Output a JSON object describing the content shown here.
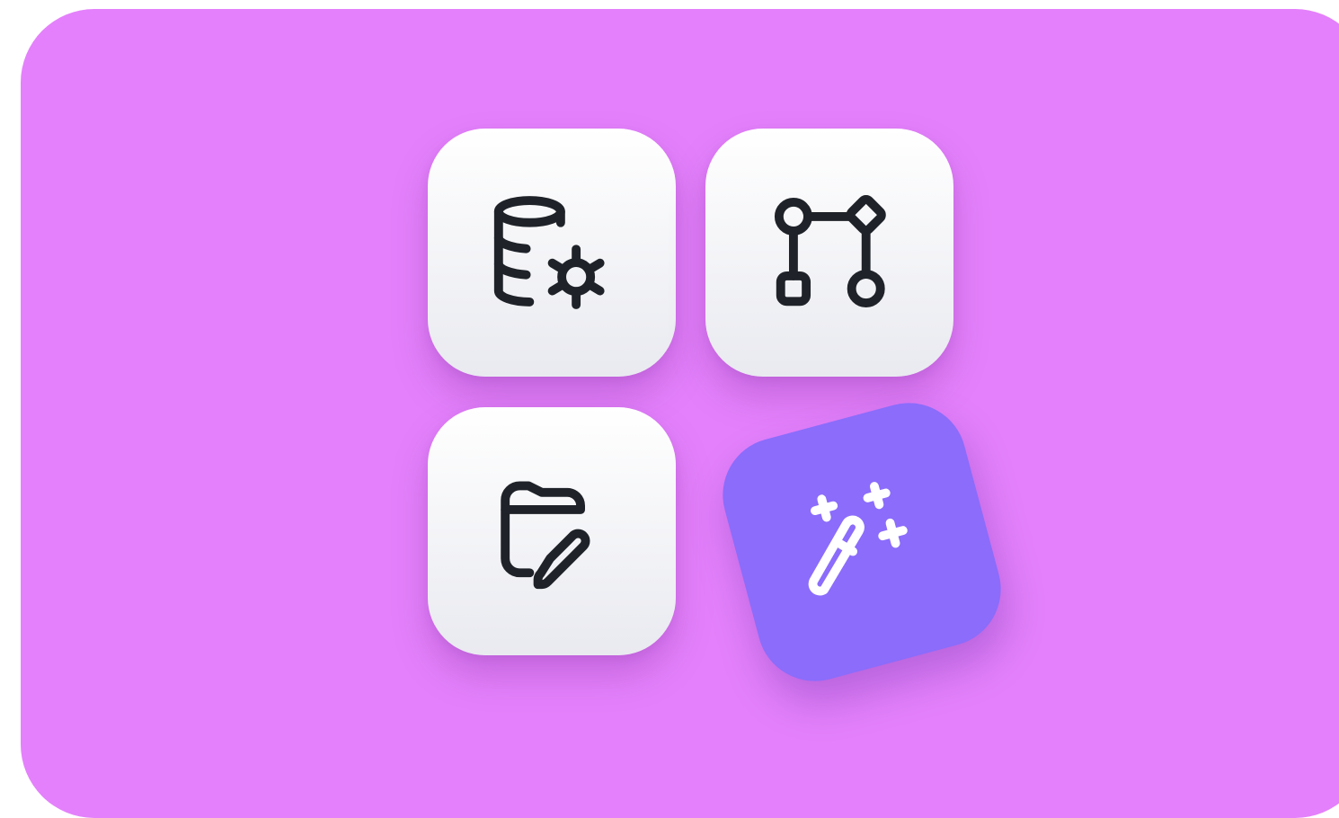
{
  "background_color": "#e480fb",
  "tiles": [
    {
      "icon": "database-cog-icon",
      "background": "#ffffff",
      "stroke": "#1f2329"
    },
    {
      "icon": "git-branch-nodes-icon",
      "background": "#ffffff",
      "stroke": "#1f2329"
    },
    {
      "icon": "folder-edit-icon",
      "background": "#ffffff",
      "stroke": "#1f2329"
    },
    {
      "icon": "magic-wand-sparkles-icon",
      "background": "#8b6cfb",
      "stroke": "#ffffff"
    }
  ]
}
